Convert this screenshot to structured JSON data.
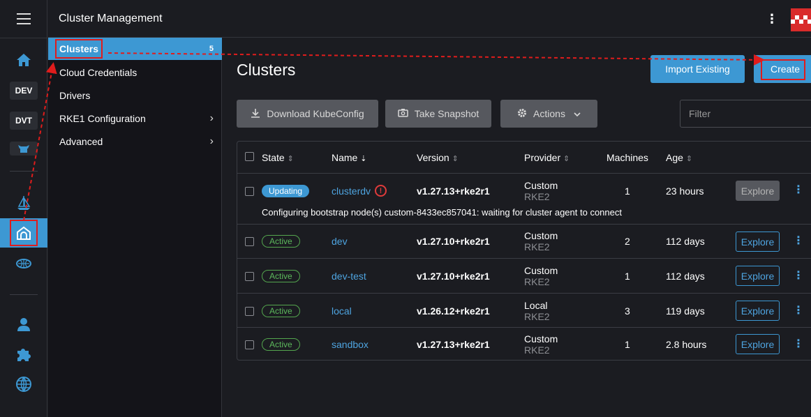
{
  "header": {
    "title": "Cluster Management"
  },
  "rail": {
    "chips": [
      "DEV",
      "DVT"
    ]
  },
  "side_menu": {
    "items": [
      {
        "label": "Clusters",
        "count": "5"
      },
      {
        "label": "Cloud Credentials"
      },
      {
        "label": "Drivers"
      },
      {
        "label": "RKE1 Configuration"
      },
      {
        "label": "Advanced"
      }
    ]
  },
  "main": {
    "title": "Clusters",
    "buttons": {
      "import": "Import Existing",
      "create": "Create",
      "download": "Download KubeConfig",
      "snapshot": "Take Snapshot",
      "actions": "Actions"
    },
    "filter_placeholder": "Filter"
  },
  "table": {
    "headers": {
      "state": "State",
      "name": "Name",
      "version": "Version",
      "provider": "Provider",
      "machines": "Machines",
      "age": "Age"
    },
    "explore_label": "Explore",
    "rows": [
      {
        "state": "Updating",
        "name": "clusterdv",
        "version": "v1.27.13+rke2r1",
        "provider": "Custom",
        "distro": "RKE2",
        "machines": "1",
        "age": "23 hours",
        "message": "Configuring bootstrap node(s) custom-8433ec857041: waiting for cluster agent to connect"
      },
      {
        "state": "Active",
        "name": "dev",
        "version": "v1.27.10+rke2r1",
        "provider": "Custom",
        "distro": "RKE2",
        "machines": "2",
        "age": "112 days"
      },
      {
        "state": "Active",
        "name": "dev-test",
        "version": "v1.27.10+rke2r1",
        "provider": "Custom",
        "distro": "RKE2",
        "machines": "1",
        "age": "112 days"
      },
      {
        "state": "Active",
        "name": "local",
        "version": "v1.26.12+rke2r1",
        "provider": "Local",
        "distro": "RKE2",
        "machines": "3",
        "age": "119 days"
      },
      {
        "state": "Active",
        "name": "sandbox",
        "version": "v1.27.13+rke2r1",
        "provider": "Custom",
        "distro": "RKE2",
        "machines": "1",
        "age": "2.8 hours"
      }
    ]
  },
  "colors": {
    "accent": "#3d98d3",
    "active": "#5cb85c",
    "annotation": "#e01c1c"
  }
}
